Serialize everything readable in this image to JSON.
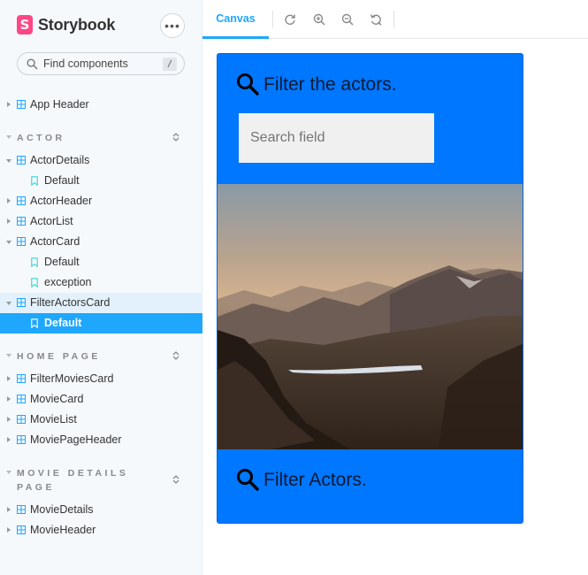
{
  "brand": {
    "name": "Storybook",
    "logo_letter": "S",
    "logo_color": "#ff4785"
  },
  "sidebar": {
    "menu_label": "•••",
    "search": {
      "placeholder": "Find components",
      "shortcut": "/"
    },
    "items": {
      "app_header": "App Header",
      "actor_section": "ACTOR",
      "actor_details": "ActorDetails",
      "actor_details_default": "Default",
      "actor_header": "ActorHeader",
      "actor_list": "ActorList",
      "actor_card": "ActorCard",
      "actor_card_default": "Default",
      "actor_card_exception": "exception",
      "filter_actors_card": "FilterActorsCard",
      "filter_actors_card_default": "Default",
      "home_section": "HOME PAGE",
      "filter_movies_card": "FilterMoviesCard",
      "movie_card": "MovieCard",
      "movie_list": "MovieList",
      "movie_page_header": "MoviePageHeader",
      "movie_details_section_line1": "MOVIE DETAILS",
      "movie_details_section_line2": "PAGE",
      "movie_details": "MovieDetails",
      "movie_header": "MovieHeader"
    }
  },
  "toolbar": {
    "tab_canvas": "Canvas",
    "icons": [
      "reload-icon",
      "zoom-in-icon",
      "zoom-out-icon",
      "zoom-reset-icon"
    ],
    "accent": "#1ea7fd"
  },
  "preview": {
    "header_text": "Filter the actors.",
    "search_placeholder": "Search field",
    "footer_text": "Filter Actors.",
    "card_color": "#0077ff"
  }
}
